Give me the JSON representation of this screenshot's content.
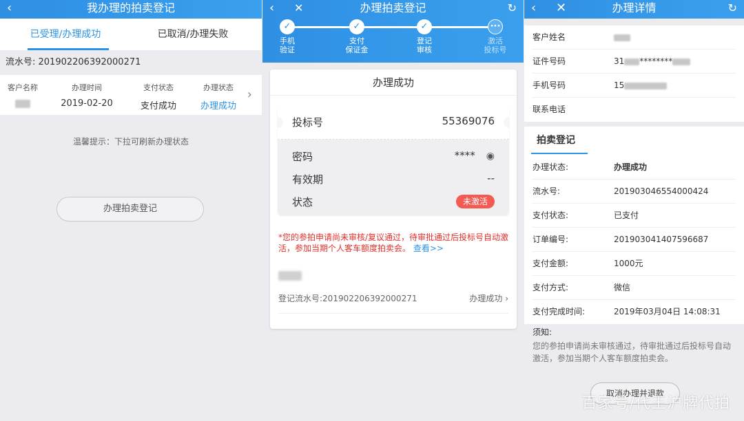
{
  "panel1": {
    "title": "我办理的拍卖登记",
    "back_icon": "‹",
    "tabs": [
      "已受理/办理成功",
      "已取消/办理失败"
    ],
    "serial": "流水号: 201902206392000271",
    "headers": [
      "客户名称",
      "办理时间",
      "支付状态",
      "办理状态"
    ],
    "row": {
      "date": "2019-02-20",
      "pay": "支付成功",
      "status": "办理成功"
    },
    "tip": "温馨提示：下拉可刷新办理状态",
    "button": "办理拍卖登记"
  },
  "panel2": {
    "title": "办理拍卖登记",
    "steps": [
      {
        "label_1": "手机",
        "label_2": "验证"
      },
      {
        "label_1": "支付",
        "label_2": "保证金"
      },
      {
        "label_1": "登记",
        "label_2": "审核"
      },
      {
        "label_1": "激活",
        "label_2": "投标号"
      }
    ],
    "card_title": "办理成功",
    "bid_label": "投标号",
    "bid_value": "55369076",
    "password_label": "密码",
    "password_value": "****",
    "validity_label": "有效期",
    "validity_value": "--",
    "status_label": "状态",
    "status_value": "未激活",
    "note": "*您的参拍申请尚未审核/复议通过，待审批通过后投标号自动激活，参加当期个人客车额度拍卖会。",
    "note_link": "查看>>",
    "reg_serial": "登记流水号:201902206392000271",
    "reg_status": "办理成功"
  },
  "panel3": {
    "title": "办理详情",
    "info": [
      {
        "k": "客户姓名"
      },
      {
        "k": "证件号码",
        "v": "31",
        "v2": "********"
      },
      {
        "k": "手机号码",
        "v": "15"
      },
      {
        "k": "联系电话"
      }
    ],
    "section": "拍卖登记",
    "details": [
      {
        "k": "办理状态:",
        "v": "办理成功"
      },
      {
        "k": "流水号:",
        "v": "201903046554000424"
      },
      {
        "k": "支付状态:",
        "v": "已支付"
      },
      {
        "k": "订单编号:",
        "v": "201903041407596687"
      },
      {
        "k": "支付金额:",
        "v": "1000元"
      },
      {
        "k": "支付方式:",
        "v": "微信"
      },
      {
        "k": "支付完成时间:",
        "v": "2019年03月04日 14:08:31"
      }
    ],
    "notice_title": "须知:",
    "notice": "您的参拍申请尚未审核通过，待审批通过后投标号自动激活，参加当期个人客车额度拍卖会。",
    "cancel_button": "取消办理并退款",
    "watermark": "百家号/代王沪牌代拍"
  },
  "colors": {
    "accent": "#2b93e6",
    "danger": "#f25a52"
  }
}
